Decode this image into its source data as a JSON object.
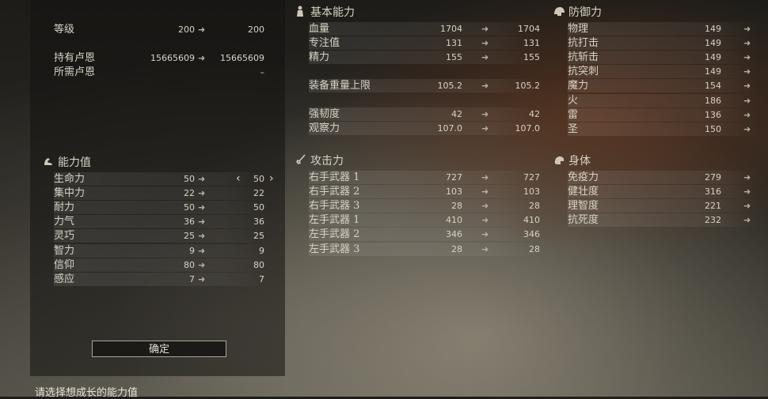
{
  "level_block": {
    "level": {
      "label": "等级",
      "current": "200",
      "next": "200"
    },
    "runes_held": {
      "label": "持有卢恩",
      "current": "15665609",
      "next": "15665609"
    },
    "runes_needed": {
      "label": "所需卢恩",
      "next": "–"
    }
  },
  "attributes": {
    "title": "能力值",
    "items": [
      {
        "label": "生命力",
        "current": "50",
        "next": "50"
      },
      {
        "label": "集中力",
        "current": "22",
        "next": "22"
      },
      {
        "label": "耐力",
        "current": "50",
        "next": "50"
      },
      {
        "label": "力气",
        "current": "36",
        "next": "36"
      },
      {
        "label": "灵巧",
        "current": "25",
        "next": "25"
      },
      {
        "label": "智力",
        "current": "9",
        "next": "9"
      },
      {
        "label": "信仰",
        "current": "80",
        "next": "80"
      },
      {
        "label": "感应",
        "current": "7",
        "next": "7"
      }
    ]
  },
  "confirm_label": "确定",
  "hint": "请选择想成长的能力值",
  "basic": {
    "title": "基本能力",
    "items": [
      {
        "label": "血量",
        "current": "1704",
        "next": "1704"
      },
      {
        "label": "专注值",
        "current": "131",
        "next": "131"
      },
      {
        "label": "精力",
        "current": "155",
        "next": "155"
      },
      {
        "label": "装备重量上限",
        "current": "105.2",
        "next": "105.2"
      },
      {
        "label": "强韧度",
        "current": "42",
        "next": "42"
      },
      {
        "label": "观察力",
        "current": "107.0",
        "next": "107.0"
      }
    ]
  },
  "attack": {
    "title": "攻击力",
    "items": [
      {
        "label": "右手武器 1",
        "current": "727",
        "next": "727"
      },
      {
        "label": "右手武器 2",
        "current": "103",
        "next": "103"
      },
      {
        "label": "右手武器 3",
        "current": "28",
        "next": "28"
      },
      {
        "label": "左手武器 1",
        "current": "410",
        "next": "410"
      },
      {
        "label": "左手武器 2",
        "current": "346",
        "next": "346"
      },
      {
        "label": "左手武器 3",
        "current": "28",
        "next": "28"
      }
    ]
  },
  "defense": {
    "title": "防御力",
    "items": [
      {
        "label": "物理",
        "value": "149"
      },
      {
        "label": "抗打击",
        "value": "149"
      },
      {
        "label": "抗斩击",
        "value": "149"
      },
      {
        "label": "抗突刺",
        "value": "149"
      },
      {
        "label": "魔力",
        "value": "154"
      },
      {
        "label": "火",
        "value": "186"
      },
      {
        "label": "雷",
        "value": "136"
      },
      {
        "label": "圣",
        "value": "150"
      }
    ]
  },
  "body": {
    "title": "身体",
    "items": [
      {
        "label": "免疫力",
        "value": "279"
      },
      {
        "label": "健壮度",
        "value": "316"
      },
      {
        "label": "理智度",
        "value": "221"
      },
      {
        "label": "抗死度",
        "value": "232"
      }
    ]
  },
  "arrow": "➜",
  "icons": {
    "attributes": "arm-flex-icon",
    "basic": "figure-icon",
    "attack": "sword-icon",
    "defense": "helmet-icon",
    "body": "body-icon"
  }
}
